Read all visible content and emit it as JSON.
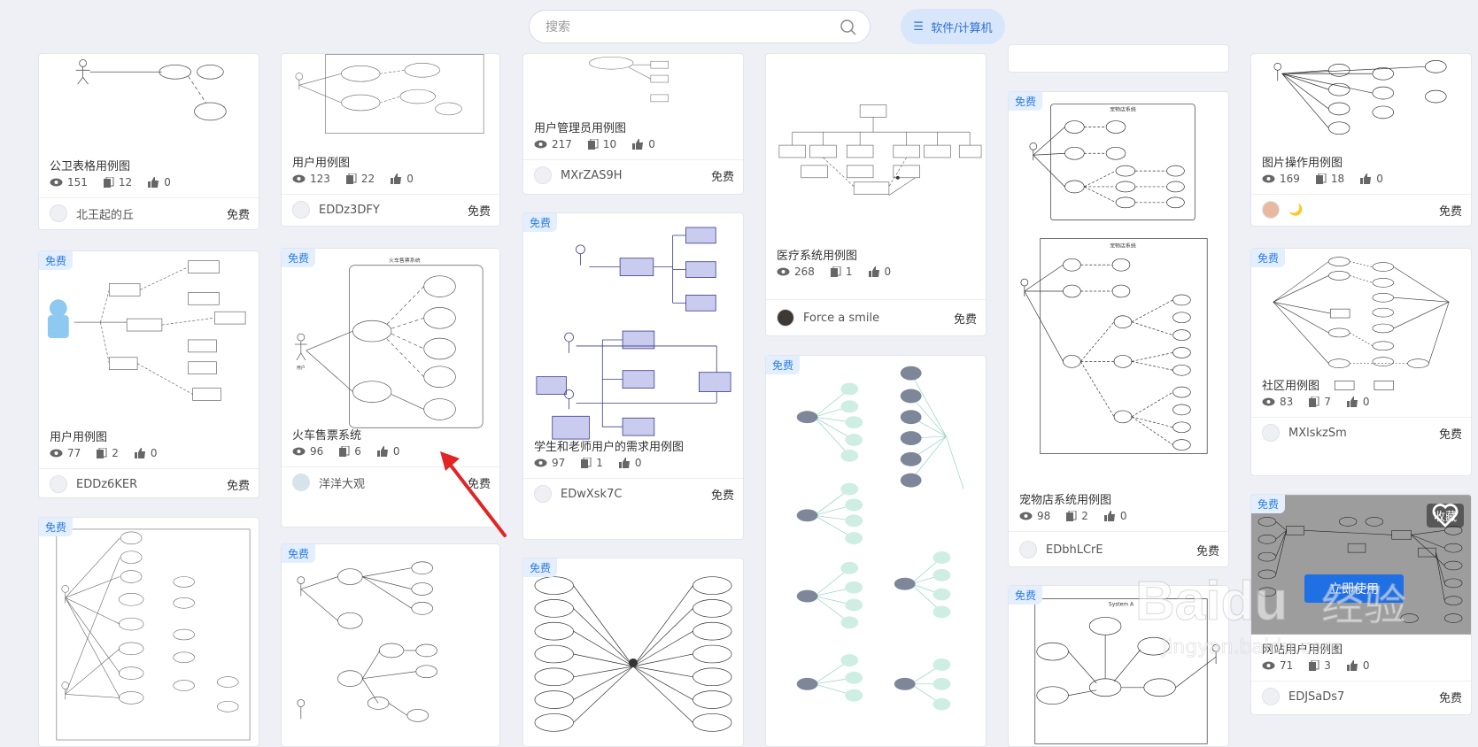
{
  "search": {
    "placeholder": "搜索"
  },
  "category_button": {
    "label": "软件/计算机"
  },
  "badge_label": "免费",
  "cards": [
    {
      "title": "公卫表格用例图",
      "views": "151",
      "copies": "12",
      "likes": "0",
      "author": "北王起的丘",
      "price": "免费"
    },
    {
      "title": "用户用例图",
      "views": "77",
      "copies": "2",
      "likes": "0",
      "author": "EDDz6KER",
      "price": "免费"
    },
    {
      "title": "用户用例图",
      "views": "123",
      "copies": "22",
      "likes": "0",
      "author": "EDDz3DFY",
      "price": "免费"
    },
    {
      "title": "火车售票系统",
      "views": "96",
      "copies": "6",
      "likes": "0",
      "author": "洋洋大观",
      "price": "免费"
    },
    {
      "title": "用户管理员用例图",
      "views": "217",
      "copies": "10",
      "likes": "0",
      "author": "MXrZAS9H",
      "price": "免费"
    },
    {
      "title": "学生和老师用户的需求用例图",
      "views": "97",
      "copies": "1",
      "likes": "0",
      "author": "EDwXsk7C",
      "price": "免费"
    },
    {
      "title": "医疗系统用例图",
      "views": "268",
      "copies": "1",
      "likes": "0",
      "author": "Force a smile",
      "price": "免费"
    },
    {
      "title": "宠物店系统用例图",
      "views": "98",
      "copies": "2",
      "likes": "0",
      "author": "EDbhLCrE",
      "price": "免费"
    },
    {
      "title": "图片操作用例图",
      "views": "169",
      "copies": "18",
      "likes": "0",
      "author": "🌙",
      "price": "免费"
    },
    {
      "title": "社区用例图",
      "views": "83",
      "copies": "7",
      "likes": "0",
      "author": "MXlskzSm",
      "price": "免费"
    },
    {
      "title": "网站用户用例图",
      "views": "71",
      "copies": "3",
      "likes": "0",
      "author": "EDJSaDs7",
      "price": "免费"
    }
  ],
  "hover_card": {
    "fav_label": "收藏",
    "use_label": "立即使用"
  },
  "diagram_texts": {
    "train_title": "火车售票系统",
    "train_actor": "用户",
    "petshop_title": "宠物店系统",
    "system_a": "System A"
  },
  "watermark": {
    "brand": "Baidu",
    "cn": "经验",
    "url": "jingyan.baidu.com"
  },
  "colors": {
    "badge_bg": "#e3efff",
    "badge_text": "#2d7be5",
    "primary": "#1f6fe5",
    "category_bg": "#d7e6fb"
  }
}
